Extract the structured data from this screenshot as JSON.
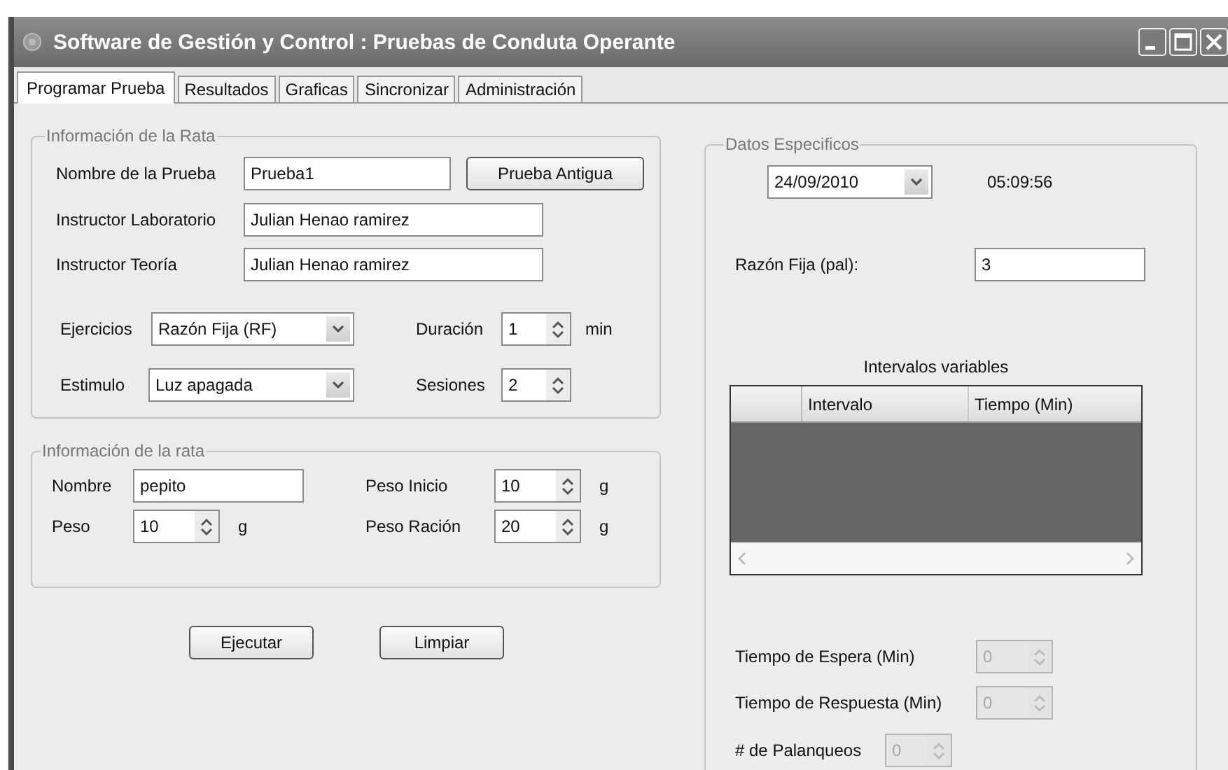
{
  "window": {
    "title": "Software de Gestión y Control : Pruebas de Conduta Operante"
  },
  "tabs": [
    {
      "label": "Programar Prueba",
      "selected": true
    },
    {
      "label": "Resultados",
      "selected": false
    },
    {
      "label": "Graficas",
      "selected": false
    },
    {
      "label": "Sincronizar",
      "selected": false
    },
    {
      "label": "Administración",
      "selected": false
    }
  ],
  "prueba_group": {
    "title": "Información de la Rata",
    "rows": [
      {
        "items": [
          {
            "kind": "label",
            "text": "Nombre de la Prueba"
          },
          {
            "kind": "text",
            "value": "Prueba1"
          },
          {
            "kind": "button",
            "label": "Prueba Antigua"
          }
        ]
      },
      {
        "items": [
          {
            "kind": "label",
            "text": "Instructor Laboratorio"
          },
          {
            "kind": "text",
            "value": "Julian Henao ramirez"
          }
        ]
      },
      {
        "items": [
          {
            "kind": "label",
            "text": "Instructor Teoría"
          },
          {
            "kind": "text",
            "value": "Julian Henao ramirez"
          }
        ]
      },
      {
        "items": [
          {
            "kind": "label",
            "text": "Ejercicios"
          },
          {
            "kind": "combo",
            "value": "Razón Fija (RF)"
          },
          {
            "kind": "label",
            "text": "Duración"
          },
          {
            "kind": "spinner",
            "value": "1",
            "disabled": false
          },
          {
            "kind": "unit",
            "text": "min"
          }
        ]
      },
      {
        "items": [
          {
            "kind": "label",
            "text": "Estimulo"
          },
          {
            "kind": "combo",
            "value": "Luz apagada"
          },
          {
            "kind": "label",
            "text": "Sesiones"
          },
          {
            "kind": "spinner",
            "value": "2",
            "disabled": false
          }
        ]
      }
    ]
  },
  "rata_group": {
    "title": "Información de la rata",
    "rows": [
      {
        "items": [
          {
            "kind": "label",
            "text": "Nombre"
          },
          {
            "kind": "text",
            "value": "pepito"
          },
          {
            "kind": "label",
            "text": "Peso Inicio"
          },
          {
            "kind": "spinner",
            "value": "10",
            "disabled": false
          },
          {
            "kind": "unit",
            "text": "g"
          }
        ]
      },
      {
        "items": [
          {
            "kind": "label",
            "text": "Peso"
          },
          {
            "kind": "spinner",
            "value": "10",
            "disabled": false
          },
          {
            "kind": "unit",
            "text": "g"
          },
          {
            "kind": "label",
            "text": "Peso Ración"
          },
          {
            "kind": "spinner",
            "value": "20",
            "disabled": false
          },
          {
            "kind": "unit",
            "text": "g"
          }
        ]
      }
    ]
  },
  "actions": {
    "rows": [
      {
        "items": [
          {
            "kind": "button",
            "label": "Ejecutar"
          },
          {
            "kind": "button",
            "label": "Limpiar"
          }
        ]
      }
    ]
  },
  "datos_group": {
    "title": "Datos Especificos",
    "rows": [
      {
        "items": [
          {
            "kind": "combo",
            "value": "24/09/2010"
          },
          {
            "kind": "label",
            "text": "05:09:56"
          }
        ]
      },
      {
        "items": [
          {
            "kind": "label",
            "text": "Razón Fija (pal):"
          },
          {
            "kind": "text",
            "value": "3"
          }
        ]
      },
      {
        "items": [
          {
            "kind": "caption",
            "text": "Intervalos variables"
          }
        ]
      },
      {
        "items": [
          {
            "kind": "grid",
            "columns": [
              "Intervalo",
              "Tiempo (Min)"
            ]
          }
        ]
      },
      {
        "items": [
          {
            "kind": "label",
            "text": "Tiempo de Espera (Min)"
          },
          {
            "kind": "spinner",
            "value": "0",
            "disabled": true
          }
        ]
      },
      {
        "items": [
          {
            "kind": "label",
            "text": "Tiempo de Respuesta (Min)"
          },
          {
            "kind": "spinner",
            "value": "0",
            "disabled": true
          }
        ]
      },
      {
        "items": [
          {
            "kind": "label",
            "text": "# de Palanqueos"
          },
          {
            "kind": "spinner",
            "value": "0",
            "disabled": true
          }
        ]
      }
    ]
  }
}
